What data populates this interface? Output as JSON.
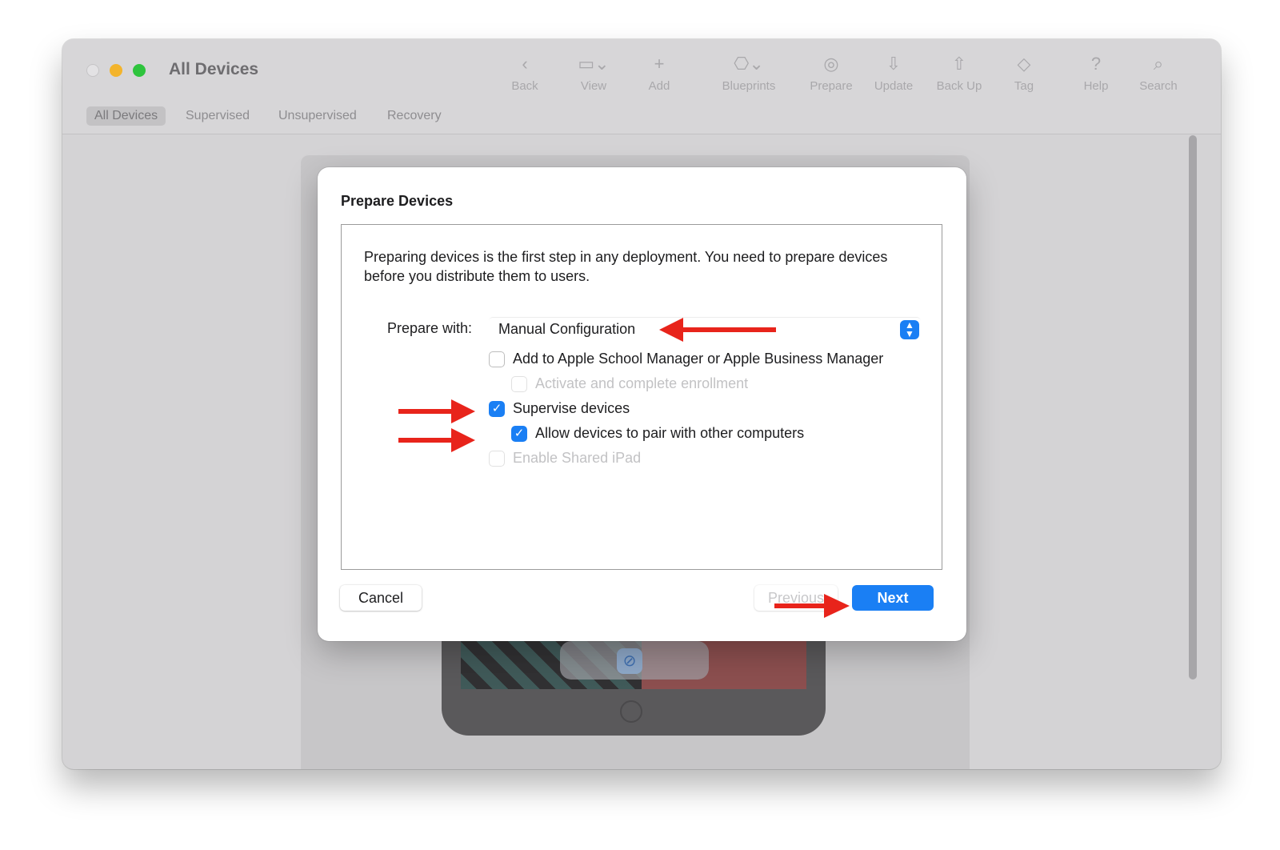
{
  "window": {
    "title": "All Devices"
  },
  "toolbar": {
    "items": [
      {
        "label": "Back",
        "icon": "chevron-left-icon",
        "glyph": "‹"
      },
      {
        "label": "View",
        "icon": "view-icon",
        "glyph": "▭⌄"
      },
      {
        "label": "Add",
        "icon": "plus-icon",
        "glyph": "+"
      },
      {
        "label": "Blueprints",
        "icon": "blueprints-icon",
        "glyph": "⎔⌄"
      },
      {
        "label": "Prepare",
        "icon": "prepare-icon",
        "glyph": "◎"
      },
      {
        "label": "Update",
        "icon": "update-icon",
        "glyph": "⇩"
      },
      {
        "label": "Back Up",
        "icon": "backup-icon",
        "glyph": "⇧"
      },
      {
        "label": "Tag",
        "icon": "tag-icon",
        "glyph": "◇"
      },
      {
        "label": "Help",
        "icon": "help-icon",
        "glyph": "?"
      },
      {
        "label": "Search",
        "icon": "search-icon",
        "glyph": "⌕"
      }
    ]
  },
  "tabs": {
    "items": [
      {
        "label": "All Devices",
        "active": true
      },
      {
        "label": "Supervised",
        "active": false
      },
      {
        "label": "Unsupervised",
        "active": false
      },
      {
        "label": "Recovery",
        "active": false
      }
    ]
  },
  "dialog": {
    "title": "Prepare Devices",
    "intro": "Preparing devices is the first step in any deployment. You need to prepare devices before you distribute them to users.",
    "prepare_with_label": "Prepare with:",
    "prepare_with_value": "Manual Configuration",
    "popup_glyph": "⌃⌄",
    "options": [
      {
        "label": "Add to Apple School Manager or Apple Business Manager",
        "checked": false,
        "enabled": true
      },
      {
        "label": "Activate and complete enrollment",
        "checked": false,
        "enabled": false
      },
      {
        "label": "Supervise devices",
        "checked": true,
        "enabled": true
      },
      {
        "label": "Allow devices to pair with other computers",
        "checked": true,
        "enabled": true
      },
      {
        "label": "Enable Shared iPad",
        "checked": false,
        "enabled": false
      }
    ],
    "check_glyph": "✓",
    "buttons": {
      "cancel": "Cancel",
      "previous": "Previous",
      "next": "Next"
    }
  },
  "annotations": {
    "arrow_color": "#e8241b"
  },
  "colors": {
    "accent": "#1a7ff4",
    "window_bg": "#d4d3d5"
  }
}
